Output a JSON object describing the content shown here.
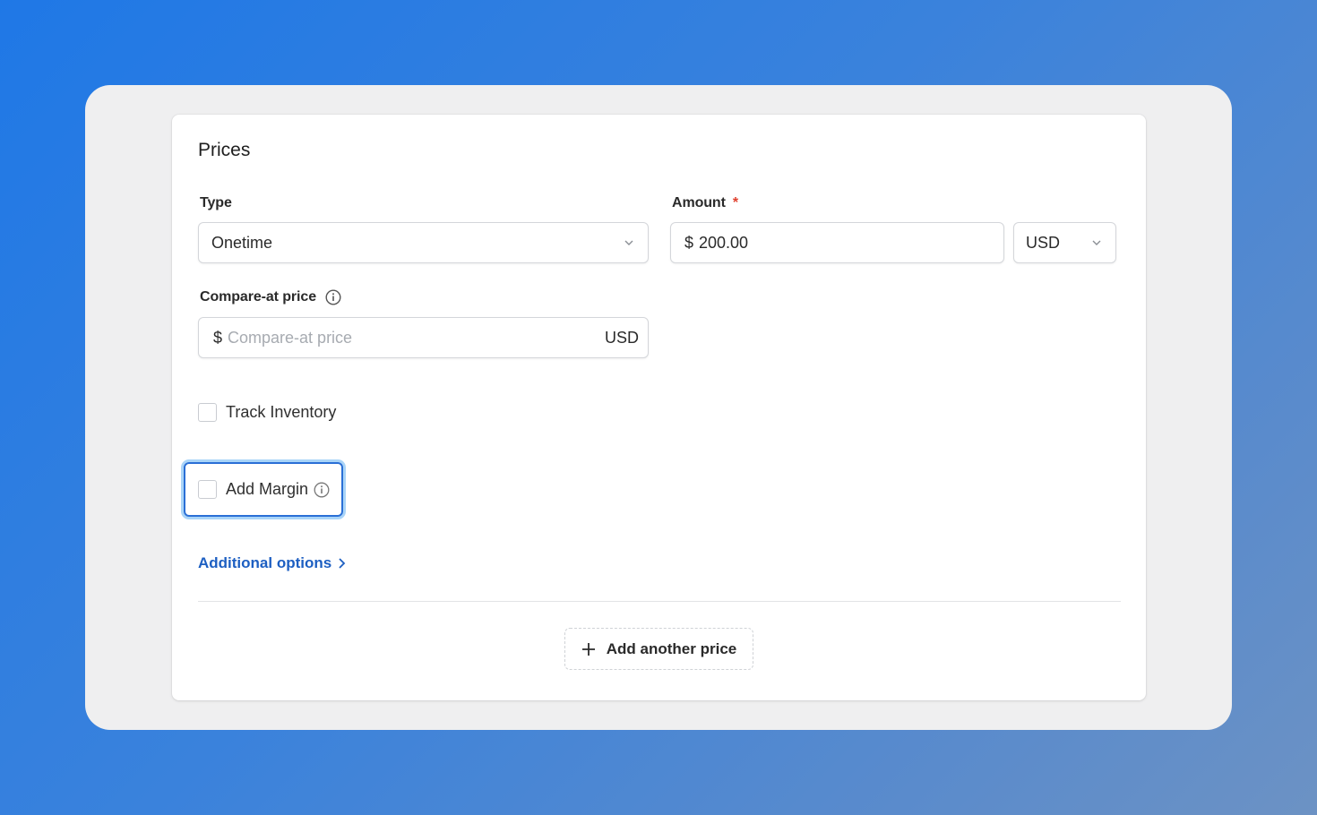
{
  "section": {
    "title": "Prices"
  },
  "type_field": {
    "label": "Type",
    "value": "Onetime"
  },
  "amount_field": {
    "label": "Amount",
    "required_mark": "*",
    "currency_symbol": "$",
    "value": "200.00",
    "currency": "USD"
  },
  "compare_field": {
    "label": "Compare-at price",
    "currency_symbol": "$",
    "placeholder": "Compare-at price",
    "currency": "USD"
  },
  "track_inventory": {
    "label": "Track Inventory",
    "checked": false
  },
  "add_margin": {
    "label": "Add Margin",
    "checked": false
  },
  "additional_options": {
    "label": "Additional options"
  },
  "add_price_button": {
    "label": "Add another price"
  },
  "colors": {
    "accent": "#1d5fc2",
    "required": "#e0412f",
    "focus_ring": "#a9d4f8"
  }
}
